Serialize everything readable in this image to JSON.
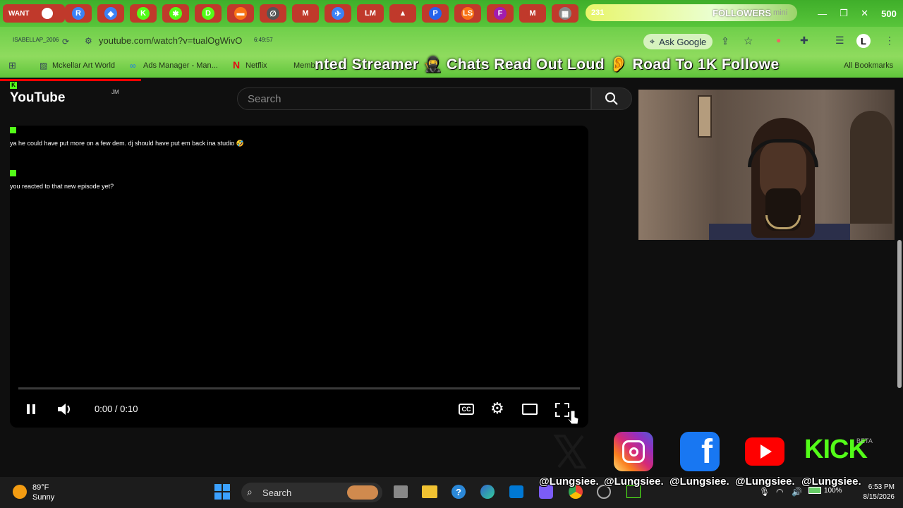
{
  "tabstrip": {
    "first_tab_label": "WANT",
    "tab_glyphs": [
      "R",
      "◆",
      "K",
      "✱",
      "D",
      "▬",
      "∅",
      "M",
      "✈",
      "LM",
      "▲",
      "P",
      "LS",
      "F",
      "M",
      "▦"
    ],
    "followers_count": "231",
    "followers_label": "FOLLOWERS",
    "mini_label": "mini",
    "followers_right_number": "500"
  },
  "address": {
    "url": "youtube.com/watch?v=tualOgWivO",
    "overlay_username": "ISABELLAP_2006",
    "overlay_time": "6:49:57",
    "ask_google": "Ask Google"
  },
  "bookmarks": {
    "items": [
      "Mckellar Art World",
      "Ads Manager - Man...",
      "Netflix",
      "Memb"
    ],
    "all_bookmarks": "All Bookmarks"
  },
  "ticker": {
    "text": "nted Streamer 🥷 Chats Read Out Loud 👂 Road To 1K Followe"
  },
  "youtube": {
    "logo_text": "YouTube",
    "logo_suffix": "JM",
    "search_placeholder": "Search"
  },
  "player": {
    "chat": [
      {
        "message": "ya he could have put more on a few dem. dj should have put em back ina studio 🤣"
      },
      {
        "message": "you reacted to that new episode yet?"
      }
    ],
    "time": "0:00 / 0:10",
    "progress_fraction": 0.0
  },
  "socials": {
    "handles": [
      "@Lungsiee.",
      "@Lungsiee.",
      "@Lungsiee.",
      "@Lungsiee.",
      "@Lungsiee."
    ],
    "kick_label": "KICK",
    "beta_label": "BETA"
  },
  "taskbar": {
    "temperature": "89°F",
    "condition": "Sunny",
    "search": "Search",
    "battery": "100%",
    "time": "6:53 PM",
    "date": "8/15/2026"
  },
  "colors": {
    "tab_red": "#c0392b",
    "chrome_green": "#6fcf4a",
    "kick_green": "#53fc18",
    "youtube_red": "#ff0000",
    "facebook_blue": "#1877f2"
  }
}
